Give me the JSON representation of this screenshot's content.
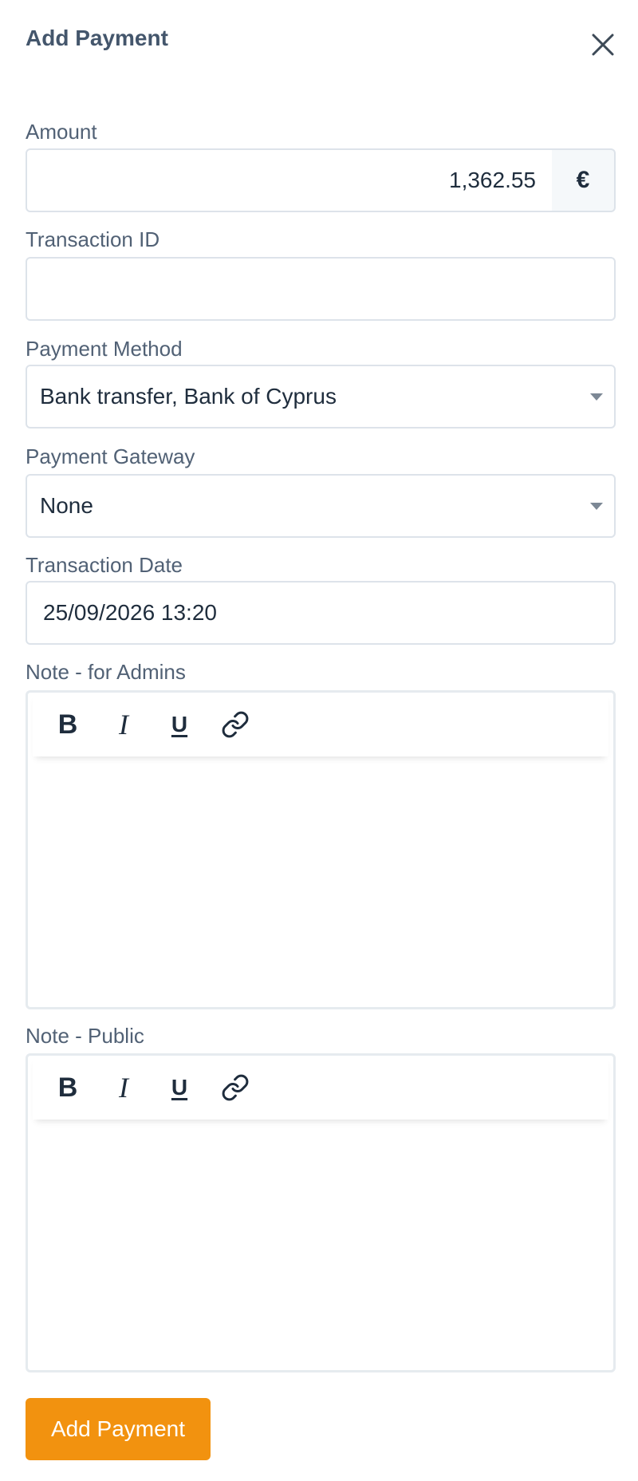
{
  "header": {
    "title": "Add Payment"
  },
  "form": {
    "amount": {
      "label": "Amount",
      "value": "1,362.55",
      "currency_symbol": "€"
    },
    "transaction_id": {
      "label": "Transaction ID",
      "value": ""
    },
    "payment_method": {
      "label": "Payment Method",
      "selected": "Bank transfer, Bank of Cyprus"
    },
    "payment_gateway": {
      "label": "Payment Gateway",
      "selected": "None"
    },
    "transaction_date": {
      "label": "Transaction Date",
      "value": "25/09/2026 13:20"
    },
    "note_admins": {
      "label": "Note - for Admins",
      "toolbar": {
        "bold": "B",
        "italic": "I",
        "underline": "U"
      }
    },
    "note_public": {
      "label": "Note - Public",
      "toolbar": {
        "bold": "B",
        "italic": "I",
        "underline": "U"
      }
    }
  },
  "footer": {
    "submit_label": "Add Payment"
  },
  "icons": {
    "close": "close-icon",
    "link": "link-icon",
    "caret": "chevron-down-icon"
  },
  "colors": {
    "accent": "#f2920f",
    "title": "#44566c",
    "label": "#516175",
    "border": "#dde3ea"
  }
}
